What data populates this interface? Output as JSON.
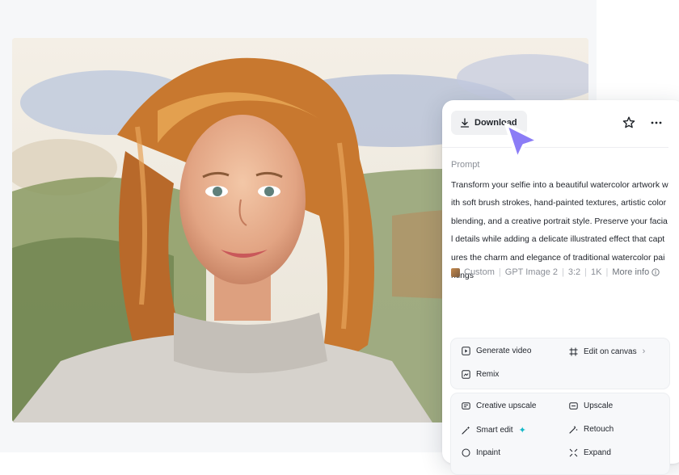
{
  "panel": {
    "download_label": "Download",
    "prompt_label": "Prompt",
    "prompt_text": "Transform your selfie into a beautiful watercolor artwork with soft brush strokes, hand-painted textures, artistic color blending, and a creative portrait style. Preserve your facial details while adding a delicate illustrated effect that captures the charm and elegance of traditional watercolor paintings",
    "meta": {
      "style": "Custom",
      "model": "GPT Image 2",
      "ratio": "3:2",
      "resolution": "1K",
      "more_info": "More info"
    },
    "actions_primary": {
      "generate_video": "Generate video",
      "edit_on_canvas": "Edit on canvas",
      "remix": "Remix"
    },
    "actions_secondary": {
      "creative_upscale": "Creative upscale",
      "upscale": "Upscale",
      "smart_edit": "Smart edit",
      "retouch": "Retouch",
      "inpaint": "Inpaint",
      "expand": "Expand"
    }
  },
  "icons": {
    "download": "download-icon",
    "star": "star-icon",
    "more": "more-horizontal-icon",
    "cursor": "pointer-cursor-icon",
    "sparkle": "sparkle-icon"
  },
  "colors": {
    "accent_cursor": "#8b7cf6",
    "sparkle": "#14b8c8"
  }
}
